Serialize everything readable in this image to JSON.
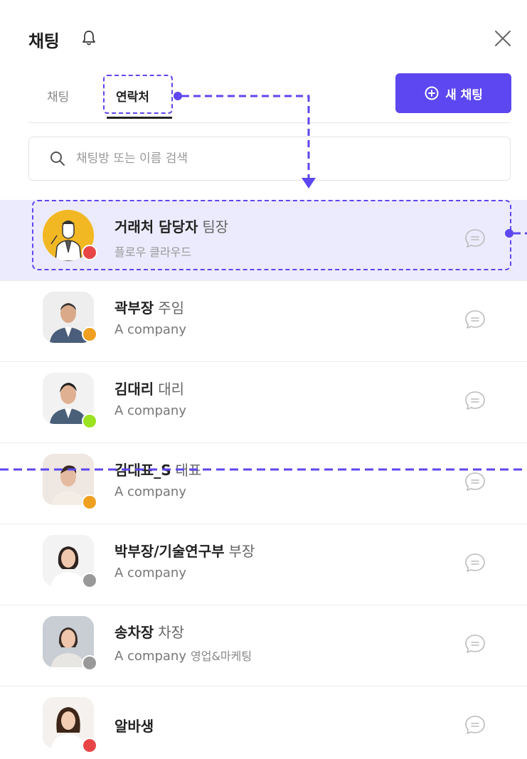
{
  "header": {
    "title": "채팅",
    "bell_icon": "bell-icon",
    "close_icon": "close-icon"
  },
  "tabs": [
    {
      "label": "채팅",
      "active": false
    },
    {
      "label": "연락처",
      "active": true
    }
  ],
  "new_chat_button": {
    "label": "새 채팅",
    "icon": "plus-circle-icon"
  },
  "search": {
    "placeholder": "채팅방 또는 이름 검색",
    "value": ""
  },
  "contacts": [
    {
      "name": "거래처 담당자",
      "title": "팀장",
      "company": "플로우 클라우드",
      "department": "",
      "status_color": "#e84646",
      "selected": true,
      "avatar": "illustrated-avatar"
    },
    {
      "name": "곽부장",
      "title": "주임",
      "company": "A company",
      "department": "",
      "status_color": "#f0a020",
      "selected": false,
      "avatar": "photo-avatar"
    },
    {
      "name": "김대리",
      "title": "대리",
      "company": "A company",
      "department": "",
      "status_color": "#9be221",
      "selected": false,
      "avatar": "photo-avatar"
    },
    {
      "name": "김대표_S",
      "title": "대표",
      "company": "A company",
      "department": "",
      "status_color": "#f0a020",
      "selected": false,
      "avatar": "photo-avatar"
    },
    {
      "name": "박부장/기술연구부",
      "title": "부장",
      "company": "A company",
      "department": "",
      "status_color": "#999999",
      "selected": false,
      "avatar": "photo-avatar"
    },
    {
      "name": "송차장",
      "title": "차장",
      "company": "A company",
      "department": "영업&마케팅",
      "status_color": "#999999",
      "selected": false,
      "avatar": "photo-avatar"
    },
    {
      "name": "알바생",
      "title": "",
      "company": "",
      "department": "",
      "status_color": "#e84646",
      "selected": false,
      "avatar": "photo-avatar"
    }
  ],
  "colors": {
    "accent": "#5c47f0",
    "selected_row": "#ecebfd",
    "annotation": "#5c47f0"
  }
}
